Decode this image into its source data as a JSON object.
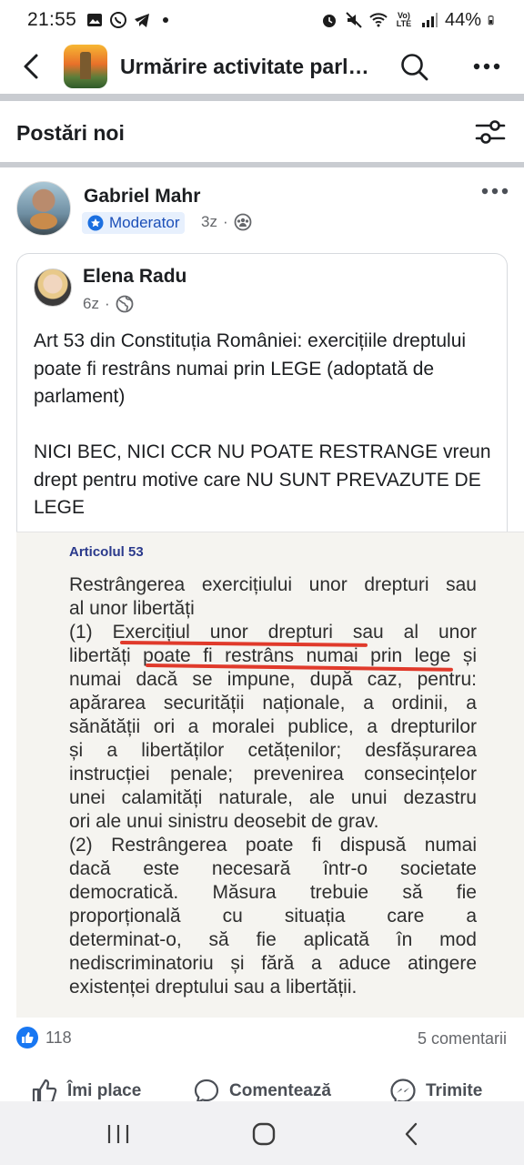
{
  "status_bar": {
    "time": "21:55",
    "battery": "44%",
    "network": "Vo) LTE"
  },
  "header": {
    "title": "Urmărire activitate parl…",
    "back_icon": "back-arrow-icon",
    "search_icon": "search-icon",
    "more_icon": "more-icon"
  },
  "section": {
    "title": "Postări noi",
    "filter_icon": "sliders-icon"
  },
  "post": {
    "author": "Gabriel Mahr",
    "badge": "Moderator",
    "time": "3z",
    "separator": "·",
    "audience_icon": "group-icon"
  },
  "shared_post": {
    "author": "Elena Radu",
    "time": "6z",
    "separator": "·",
    "audience_icon": "globe-icon",
    "text": "Art 53 din Constituția României: exercițiile dreptului poate fi restrâns numai prin LEGE (adoptată de parlament)\n\nNICI BEC, NICI CCR NU POATE RESTRANGE vreun drept pentru motive care NU SUNT PREVAZUTE DE LEGE"
  },
  "document": {
    "heading": "Articolul 53",
    "lines": [
      "Restrângerea exercițiului unor drepturi sau",
      "al unor libertăți",
      "(1) Exercițiul unor drepturi sau al unor",
      "libertăți poate fi restrâns numai prin lege și",
      "numai dacă se impune, după caz, pentru:",
      "apărarea securității naționale, a ordinii, a",
      "sănătății ori a moralei publice, a drepturilor",
      "și a libertăților cetățenilor; desfășurarea",
      "instrucției penale; prevenirea consecințelor",
      "unei calamități naturale, ale unui dezastru",
      "ori ale unui sinistru deosebit de grav.",
      "(2) Restrângerea poate fi dispusă numai",
      "dacă este necesară într-o societate",
      "democratică. Măsura trebuie să fie",
      "proporțională cu situația care a",
      "determinat-o, să fie aplicată în mod",
      "nediscriminatoriu și fără a aduce atingere",
      "existenței dreptului sau a libertății."
    ]
  },
  "reactions": {
    "likes": "118",
    "comments": "5 comentarii"
  },
  "actions": {
    "like": "Îmi place",
    "comment": "Comentează",
    "send": "Trimite"
  },
  "colors": {
    "accent": "#1877f2",
    "underline": "#e03a2b",
    "badge_bg": "#e7f0fd",
    "badge_text": "#1b4fb8"
  }
}
